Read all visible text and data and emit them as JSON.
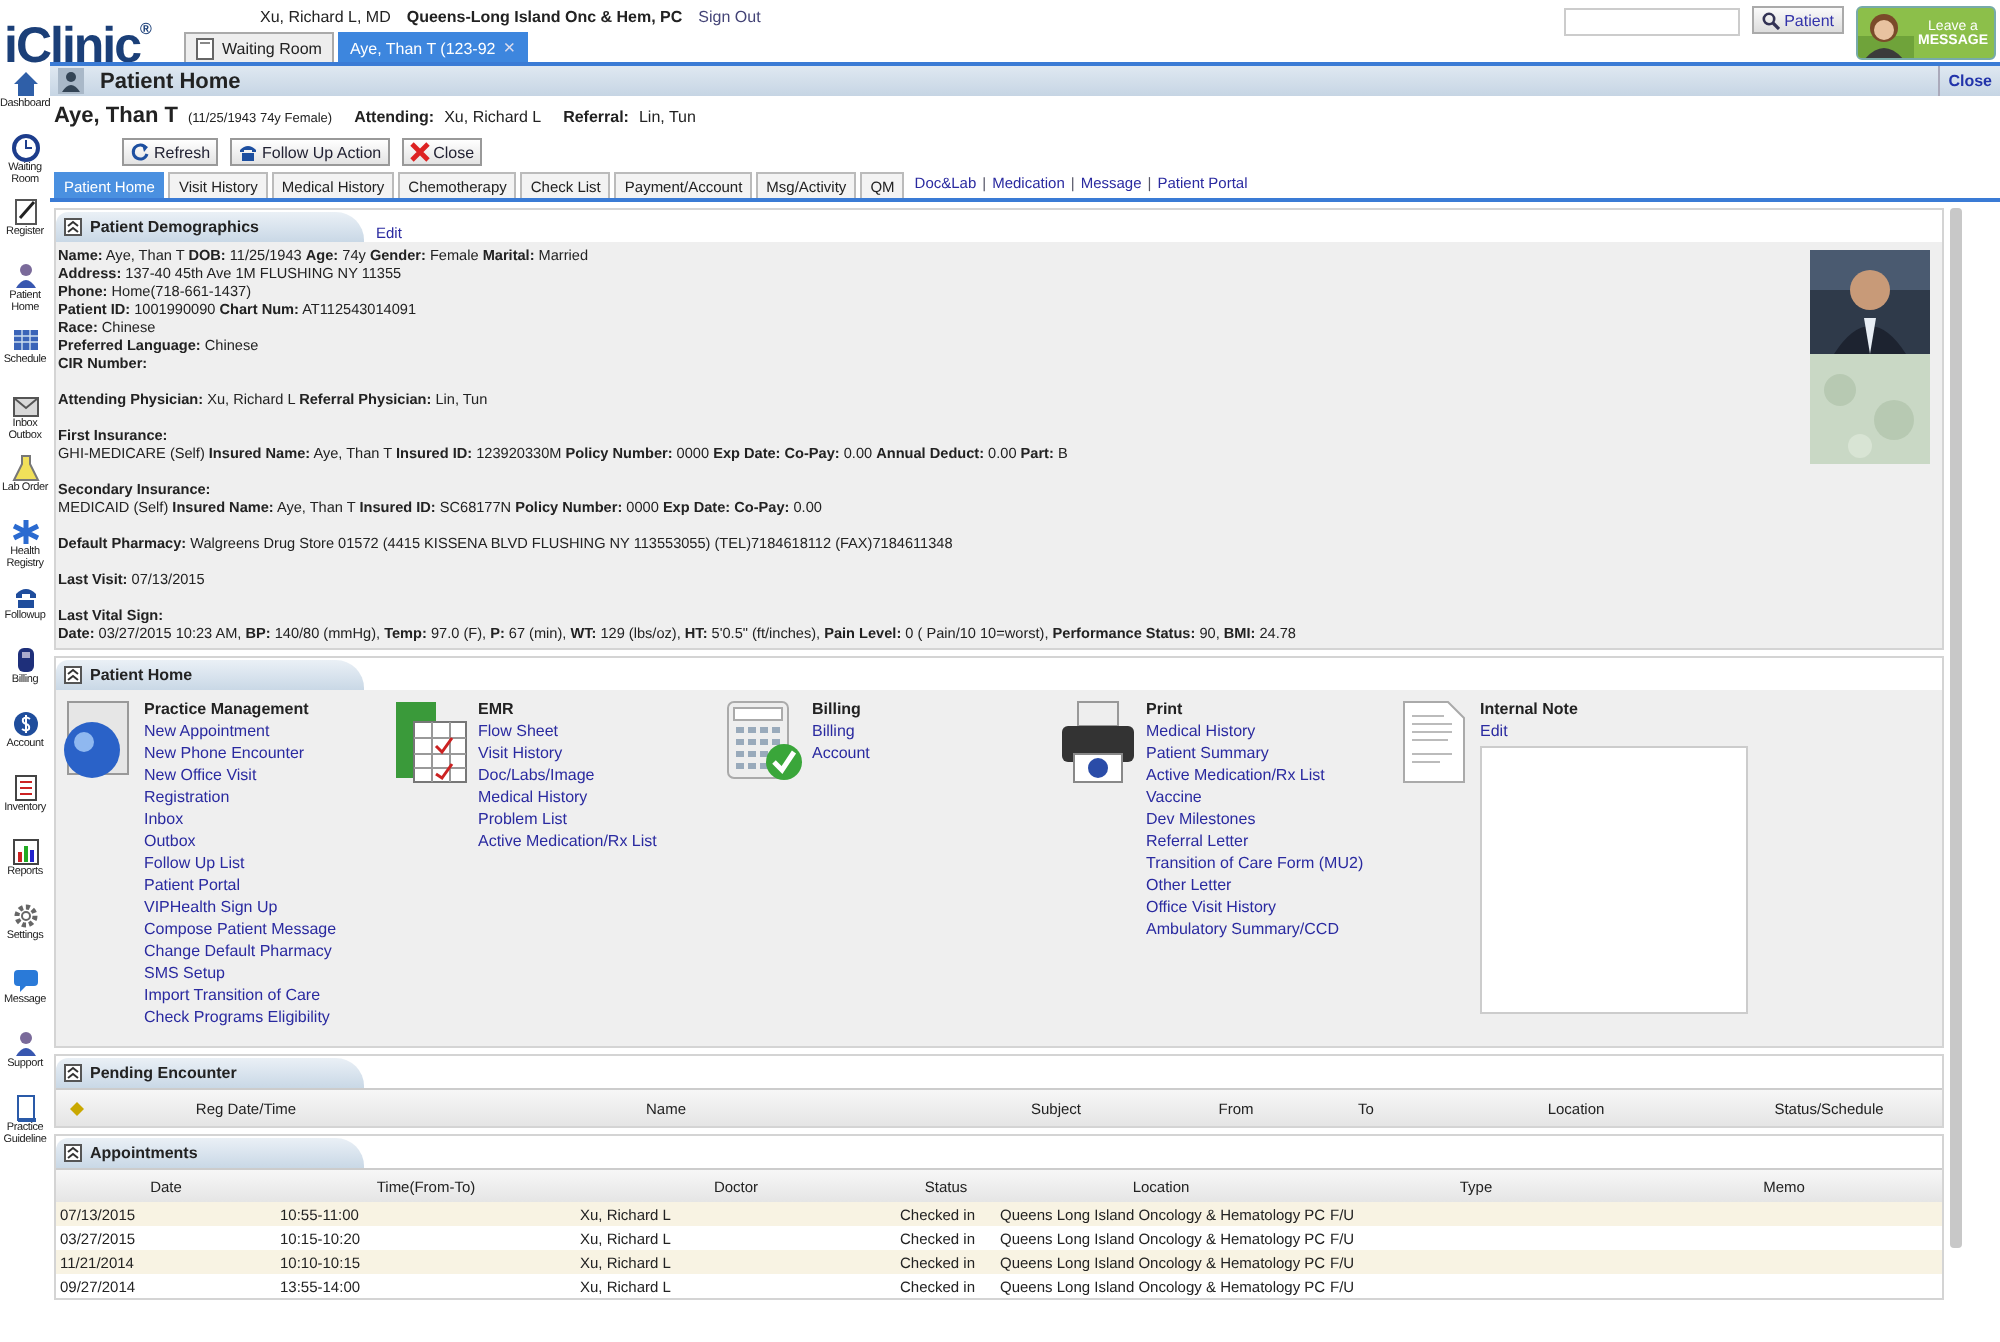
{
  "logo": "iClinic$^{®}$",
  "header": {
    "user": "Xu, Richard L, MD",
    "practice": "Queens-Long Island Onc & Hem, PC",
    "sign_out": "Sign Out"
  },
  "window_tabs": [
    {
      "label": "Waiting Room",
      "selected": false
    },
    {
      "label": "Aye, Than T (123-92",
      "selected": true,
      "close": "×"
    }
  ],
  "search": {
    "button": "Patient"
  },
  "message_banner": {
    "line1": "Leave a",
    "line2": "MESSAGE"
  },
  "sidebar": [
    "Dashboard",
    "Waiting Room",
    "Register",
    "Patient Home",
    "Schedule",
    "Inbox Outbox",
    "Lab Order",
    "Health Registry",
    "Followup",
    "Billing",
    "Account",
    "Inventory",
    "Reports",
    "Settings",
    "Message",
    "Support",
    "Practice Guideline"
  ],
  "page": {
    "title": "Patient Home",
    "close": "Close"
  },
  "patient": {
    "name": "Aye, Than T",
    "info": "(11/25/1943 74y Female)",
    "attending_label": "Attending:",
    "attending": "Xu, Richard L",
    "referral_label": "Referral:",
    "referral": "Lin, Tun"
  },
  "actions": [
    {
      "kind": "refresh",
      "label": "Refresh"
    },
    {
      "kind": "phone",
      "label": "Follow Up Action"
    },
    {
      "kind": "close",
      "label": "Close"
    }
  ],
  "tabs": [
    {
      "label": "Patient Home",
      "selected": true
    },
    {
      "label": "Visit History",
      "selected": false
    },
    {
      "label": "Medical History",
      "selected": false
    },
    {
      "label": "Chemotherapy",
      "selected": false
    },
    {
      "label": "Check List",
      "selected": false
    },
    {
      "label": "Payment/Account",
      "selected": false
    },
    {
      "label": "Msg/Activity",
      "selected": false
    },
    {
      "label": "QM",
      "selected": false
    }
  ],
  "tab_links": [
    {
      "kind": "link",
      "text": "Doc&Lab"
    },
    {
      "kind": "separator",
      "text": "|"
    },
    {
      "kind": "link",
      "text": "Medication"
    },
    {
      "kind": "separator",
      "text": "|"
    },
    {
      "kind": "link",
      "text": "Message"
    },
    {
      "kind": "separator",
      "text": "|"
    },
    {
      "kind": "link",
      "text": "Patient Portal"
    }
  ],
  "demographics": {
    "title": "Patient Demographics",
    "edit": "Edit",
    "groups": [
      [
        "**Name:** Aye, Than T **DOB:** 11/25/1943 **Age:** 74y **Gender:** Female **Marital:** Married",
        "**Address:** 137-40 45th Ave 1M FLUSHING NY 11355",
        "**Phone:** Home(718-661-1437)",
        "**Patient ID:** 1001990090 **Chart Num:** AT112543014091",
        "**Race:** Chinese",
        "**Preferred Language:** Chinese",
        "**CIR Number:**"
      ],
      [
        "**Attending Physician:** Xu, Richard L **Referral Physician:** Lin, Tun"
      ],
      [
        "**First Insurance:**",
        "GHI-MEDICARE (Self) **Insured Name:** Aye, Than T **Insured ID:** 123920330M **Policy Number:** 0000 **Exp Date:**  **Co-Pay:** 0.00 **Annual Deduct:** 0.00 **Part:** B"
      ],
      [
        "**Secondary Insurance:**",
        "MEDICAID (Self) **Insured Name:** Aye, Than T **Insured ID:** SC68177N **Policy Number:** 0000 **Exp Date:**  **Co-Pay:** 0.00"
      ],
      [
        "**Default Pharmacy:** Walgreens Drug Store 01572 (4415 KISSENA BLVD FLUSHING NY 113553055) (TEL)7184618112 (FAX)7184611348"
      ],
      [
        "**Last Visit:** 07/13/2015"
      ],
      [
        "**Last Vital Sign:**",
        "**Date:** 03/27/2015 10:23 AM, **BP:** 140/80 (mmHg), **Temp:** 97.0 (F), **P:** 67 (min), **WT:** 129 (lbs/oz), **HT:** 5'0.5\" (ft/inches), **Pain Level:** 0 ( Pain/10 10=worst), **Performance Status:** 90, **BMI:** 24.78"
      ]
    ]
  },
  "patient_home": {
    "title": "Patient Home",
    "columns": [
      {
        "kind": "practice",
        "title": "Practice Management",
        "links": [
          "New Appointment",
          "New Phone Encounter",
          "New Office Visit",
          "Registration",
          "Inbox",
          "Outbox",
          "Follow Up List",
          "Patient Portal",
          "VIPHealth Sign Up",
          "Compose Patient Message",
          "Change Default Pharmacy",
          "SMS Setup",
          "Import Transition of Care",
          "Check Programs Eligibility"
        ]
      },
      {
        "kind": "emr",
        "title": "EMR",
        "links": [
          "Flow Sheet",
          "Visit History",
          "Doc/Labs/Image",
          "Medical History",
          "Problem List",
          "Active Medication/Rx List"
        ]
      },
      {
        "kind": "billing",
        "title": "Billing",
        "links": [
          "Billing",
          "Account"
        ]
      },
      {
        "kind": "print",
        "title": "Print",
        "links": [
          "Medical History",
          "Patient Summary",
          "Active Medication/Rx List",
          "Vaccine",
          "Dev Milestones",
          "Referral Letter",
          "Transition of Care Form (MU2)",
          "Other Letter",
          "Office Visit History",
          "Ambulatory Summary/CCD"
        ]
      },
      {
        "kind": "note",
        "title": "Internal Note",
        "links": [
          "Edit"
        ]
      }
    ]
  },
  "pending": {
    "title": "Pending Encounter",
    "columns": [
      "Reg Date/Time",
      "Name",
      "Subject",
      "From",
      "To",
      "Location",
      "Status/Schedule"
    ]
  },
  "appointments": {
    "title": "Appointments",
    "columns": [
      "Date",
      "Time(From-To)",
      "Doctor",
      "Status",
      "Location",
      "Type",
      "Memo"
    ],
    "rows": [
      [
        "07/13/2015",
        "10:55-11:00",
        "Xu, Richard L",
        "Checked in",
        "Queens Long Island Oncology & Hematology PC",
        "F/U"
      ],
      [
        "03/27/2015",
        "10:15-10:20",
        "Xu, Richard L",
        "Checked in",
        "Queens Long Island Oncology & Hematology PC",
        "F/U"
      ],
      [
        "11/21/2014",
        "10:10-10:15",
        "Xu, Richard L",
        "Checked in",
        "Queens Long Island Oncology & Hematology PC",
        "F/U"
      ],
      [
        "09/27/2014",
        "13:55-14:00",
        "Xu, Richard L",
        "Checked in",
        "Queens Long Island Oncology & Hematology PC",
        "F/U"
      ]
    ]
  }
}
